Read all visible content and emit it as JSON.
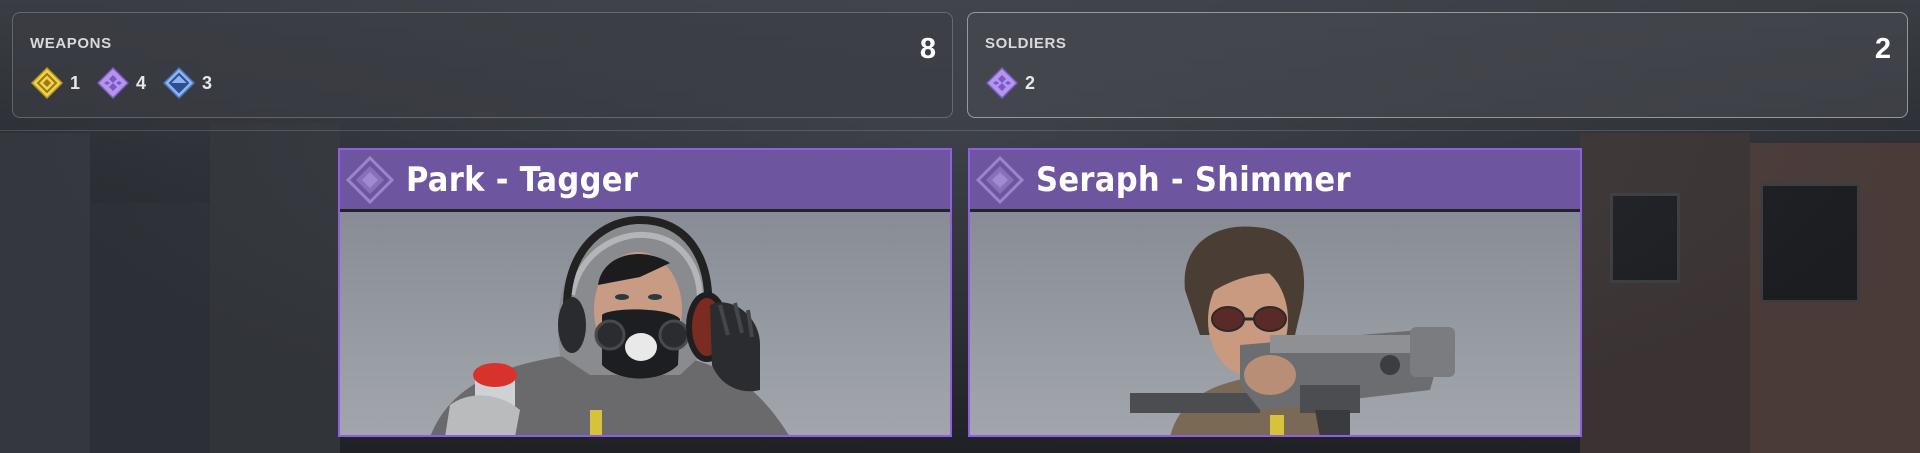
{
  "weapons": {
    "label": "WEAPONS",
    "total": "8",
    "chips": [
      {
        "icon": "gold-rarity-icon",
        "color": "#e8c63a",
        "count": "1"
      },
      {
        "icon": "purple-rarity-icon",
        "color": "#a07ee0",
        "count": "4"
      },
      {
        "icon": "blue-rarity-icon",
        "color": "#6f9ee6",
        "count": "3"
      }
    ]
  },
  "soldiers": {
    "label": "SOLDIERS",
    "total": "2",
    "chips": [
      {
        "icon": "purple-rarity-icon",
        "color": "#a07ee0",
        "count": "2"
      }
    ]
  },
  "cards": [
    {
      "name": "Park - Tagger",
      "rarity_color": "#8e5fe0"
    },
    {
      "name": "Seraph - Shimmer",
      "rarity_color": "#8e5fe0"
    }
  ]
}
